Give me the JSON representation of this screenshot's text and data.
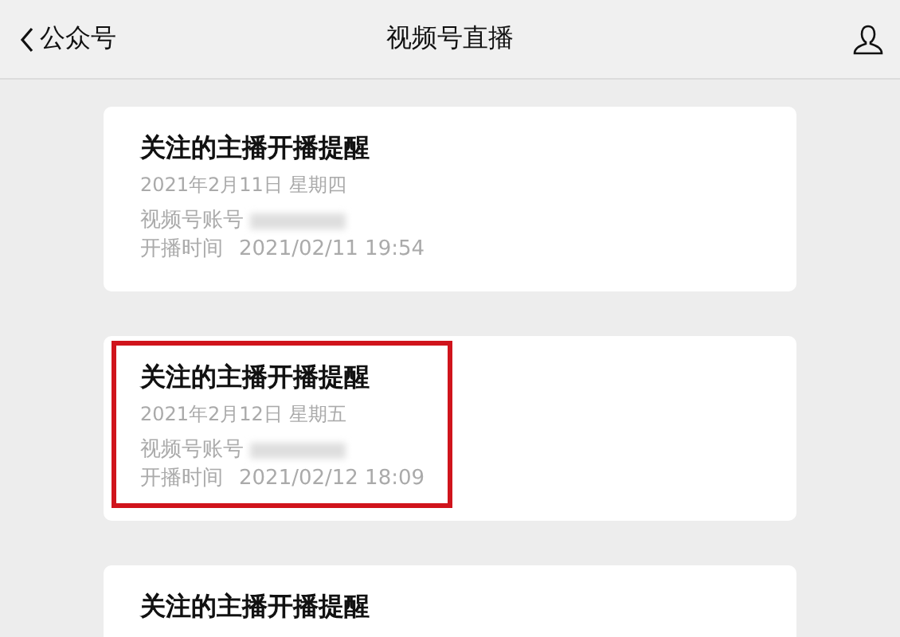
{
  "nav": {
    "back_label": "公众号",
    "title": "视频号直播"
  },
  "cards": [
    {
      "title": "关注的主播开播提醒",
      "date": "2021年2月11日 星期四",
      "account_label": "视频号账号",
      "account_blurred": true,
      "time_label": "开播时间",
      "time": "2021/02/11 19:54",
      "highlighted": false
    },
    {
      "title": "关注的主播开播提醒",
      "date": "2021年2月12日 星期五",
      "account_label": "视频号账号",
      "account_blurred": true,
      "time_label": "开播时间",
      "time": "2021/02/12 18:09",
      "highlighted": true
    },
    {
      "title": "关注的主播开播提醒",
      "highlighted": false
    }
  ]
}
